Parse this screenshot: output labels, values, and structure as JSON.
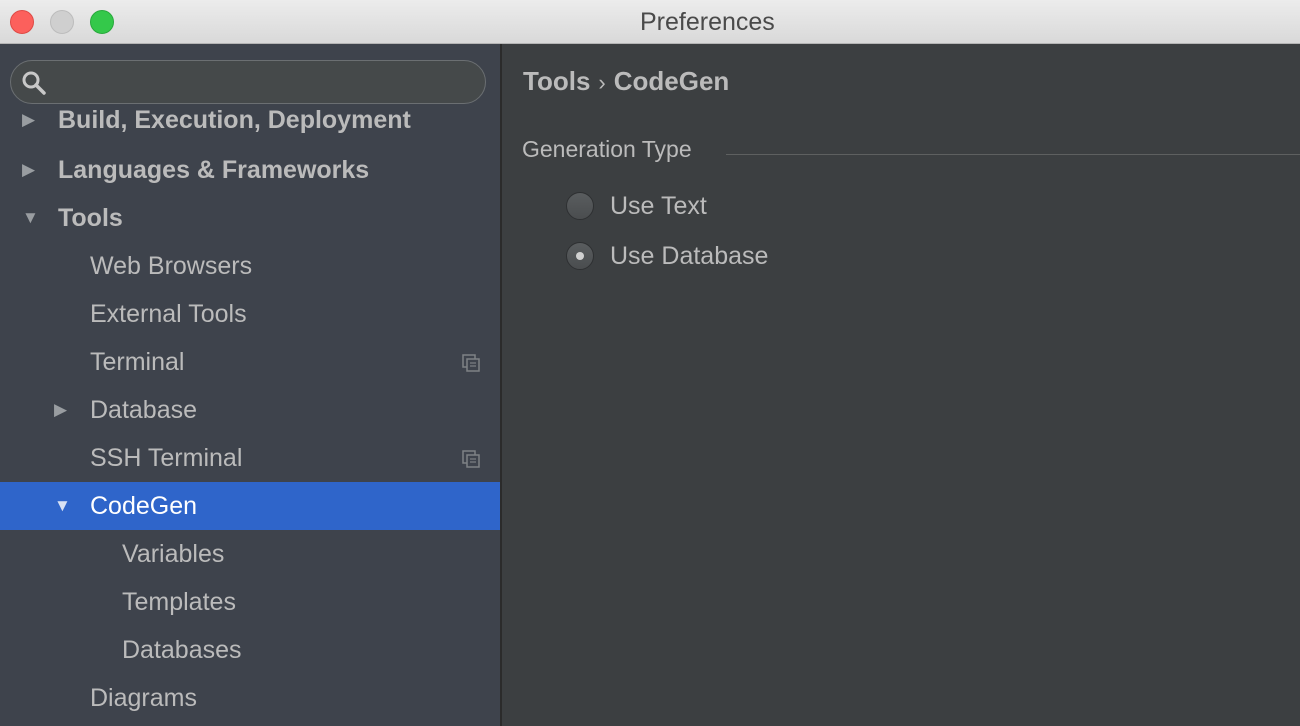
{
  "window": {
    "title": "Preferences"
  },
  "search": {
    "placeholder": "",
    "value": ""
  },
  "tree": {
    "items": [
      {
        "label": "Build, Execution, Deployment"
      },
      {
        "label": "Languages & Frameworks"
      },
      {
        "label": "Tools"
      },
      {
        "label": "Web Browsers"
      },
      {
        "label": "External Tools"
      },
      {
        "label": "Terminal"
      },
      {
        "label": "Database"
      },
      {
        "label": "SSH Terminal"
      },
      {
        "label": "CodeGen"
      },
      {
        "label": "Variables"
      },
      {
        "label": "Templates"
      },
      {
        "label": "Databases"
      },
      {
        "label": "Diagrams"
      }
    ],
    "selected": "CodeGen"
  },
  "breadcrumb": {
    "parent": "Tools",
    "separator": "›",
    "current": "CodeGen"
  },
  "generation": {
    "title": "Generation Type",
    "options": [
      {
        "label": "Use Text",
        "checked": false
      },
      {
        "label": "Use Database",
        "checked": true
      }
    ]
  },
  "colors": {
    "selection": "#2f65ca",
    "sidebar_bg": "#3e434c",
    "content_bg": "#3c3f41",
    "text": "#bbbbbb"
  }
}
